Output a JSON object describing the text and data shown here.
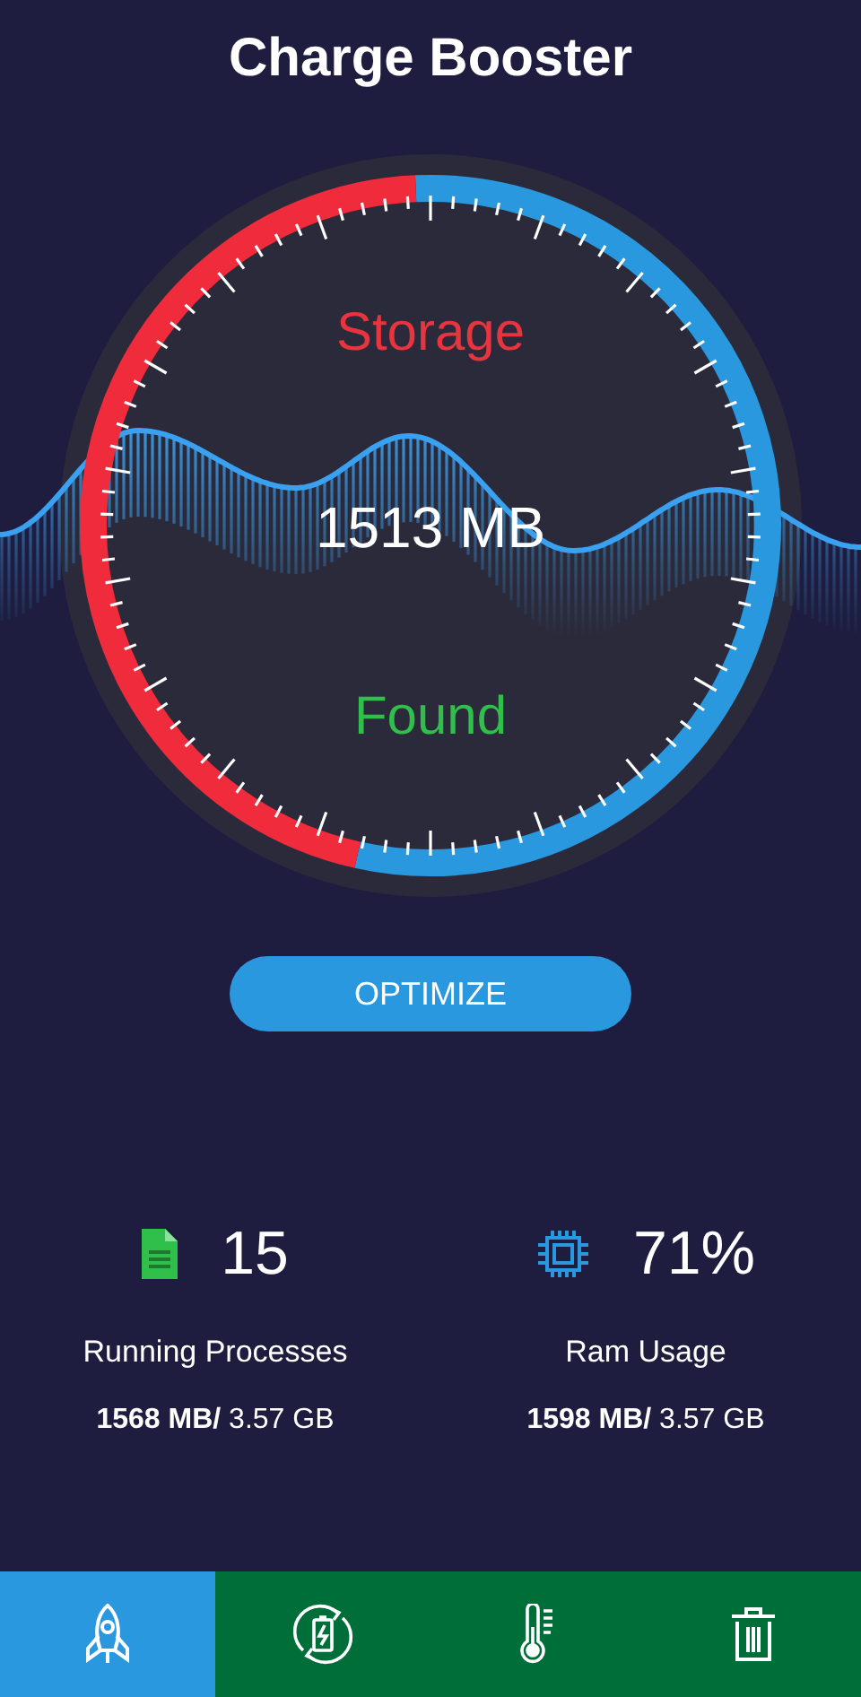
{
  "title": "Charge Booster",
  "gauge": {
    "label_top": "Storage",
    "value": "1513 MB",
    "label_bottom": "Found"
  },
  "optimize_button": "OPTIMIZE",
  "stats": [
    {
      "kind": "processes",
      "value": "15",
      "label": "Running Processes",
      "usage": "**1568 MB/** 3.57 GB"
    },
    {
      "kind": "ram",
      "value": "71%",
      "label": "Ram Usage",
      "usage": "**1598 MB/** 3.57 GB"
    }
  ],
  "nav_tabs": [
    {
      "kind": "boost",
      "selected": true
    },
    {
      "kind": "battery",
      "selected": false
    },
    {
      "kind": "temperature",
      "selected": false
    },
    {
      "kind": "clean",
      "selected": false
    }
  ]
}
